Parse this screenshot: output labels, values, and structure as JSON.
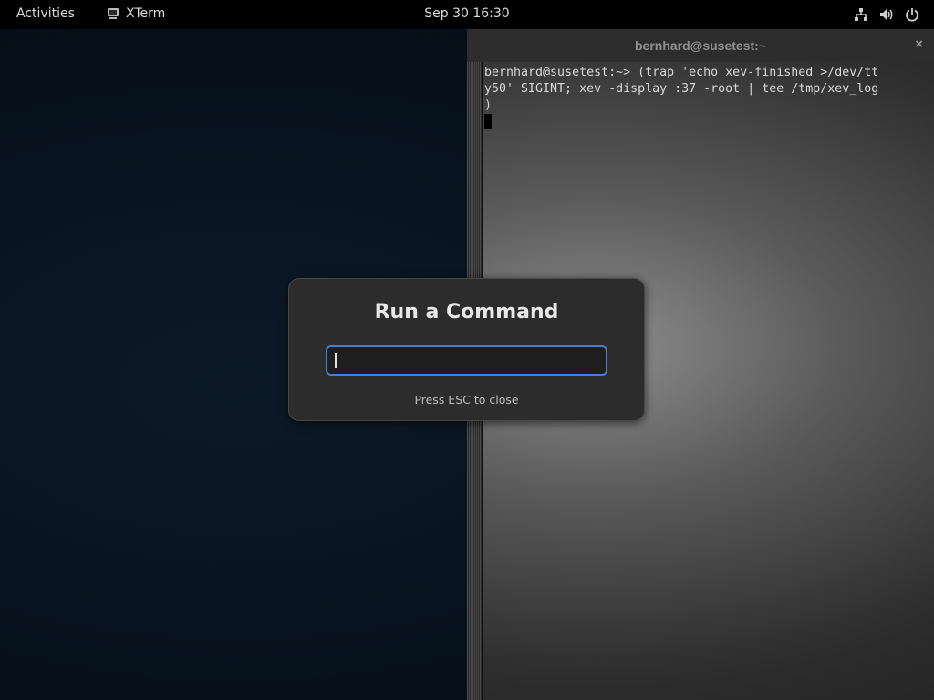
{
  "topbar": {
    "activities_label": "Activities",
    "app_name": "XTerm",
    "app_icon": "terminal-icon",
    "clock": "Sep 30  16:30",
    "status_icons": [
      "network-icon",
      "volume-icon",
      "power-icon"
    ]
  },
  "xterm": {
    "title": "bernhard@susetest:~",
    "close_glyph": "×",
    "lines": [
      "bernhard@susetest:~> (trap 'echo xev-finished >/dev/tt",
      "y50' SIGINT; xev -display :37 -root | tee /tmp/xev_log",
      ")"
    ]
  },
  "run_dialog": {
    "title": "Run a Command",
    "input_value": "",
    "hint": "Press ESC to close"
  },
  "colors": {
    "accent": "#3f7fd6",
    "topbar_bg": "#000000",
    "dialog_bg": "#2c2c2c"
  }
}
